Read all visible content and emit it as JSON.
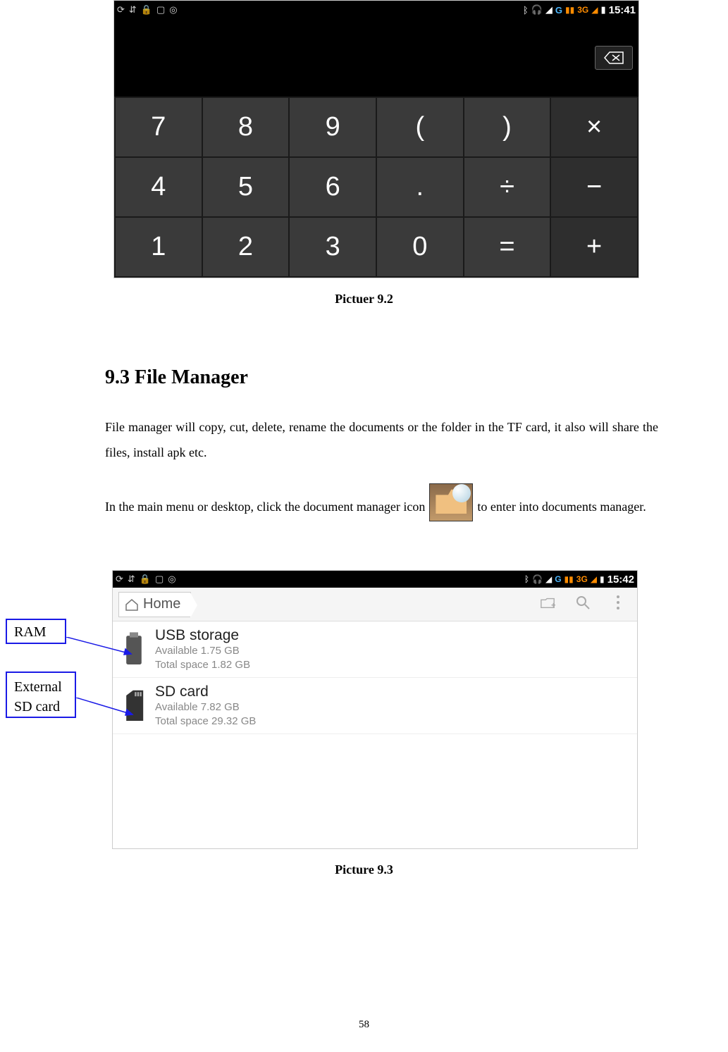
{
  "status_bar": {
    "left_icons": [
      "sync-icon",
      "wifi-icon",
      "lock-icon",
      "screenshot-icon",
      "target-icon"
    ],
    "bluetooth": "bt",
    "headphones": "hp",
    "wifi": "wifi",
    "g_label": "G",
    "signal_label": "3G",
    "battery": "bat",
    "time1": "15:41",
    "time2": "15:42"
  },
  "calculator": {
    "backspace_label": "⌫",
    "rows": [
      [
        "7",
        "8",
        "9",
        "(",
        ")",
        "×"
      ],
      [
        "4",
        "5",
        "6",
        ".",
        "÷",
        "−"
      ],
      [
        "1",
        "2",
        "3",
        "0",
        "=",
        "+"
      ]
    ]
  },
  "caption1": "Pictuer 9.2",
  "heading": "9.3 File Manager",
  "para1": "File manager will copy, cut, delete, rename the documents or the folder in the TF card, it also will share the files, install apk etc.",
  "para2_before": "In the main menu or desktop, click the document manager icon ",
  "para2_after": " to enter into documents manager.",
  "file_manager": {
    "breadcrumb_label": "Home",
    "folder_add_icon": "folder-add-icon",
    "search_icon": "search-icon",
    "overflow_icon": "overflow-icon",
    "items": [
      {
        "name": "usb-storage",
        "title": "USB storage",
        "available": "Available 1.75 GB",
        "total": "Total space 1.82 GB"
      },
      {
        "name": "sd-card",
        "title": "SD card",
        "available": "Available 7.82 GB",
        "total": "Total space 29.32 GB"
      }
    ]
  },
  "annotations": {
    "ram": "RAM",
    "sd_line1": "External",
    "sd_line2": "SD card"
  },
  "caption2": "Picture 9.3",
  "page_number": "58"
}
